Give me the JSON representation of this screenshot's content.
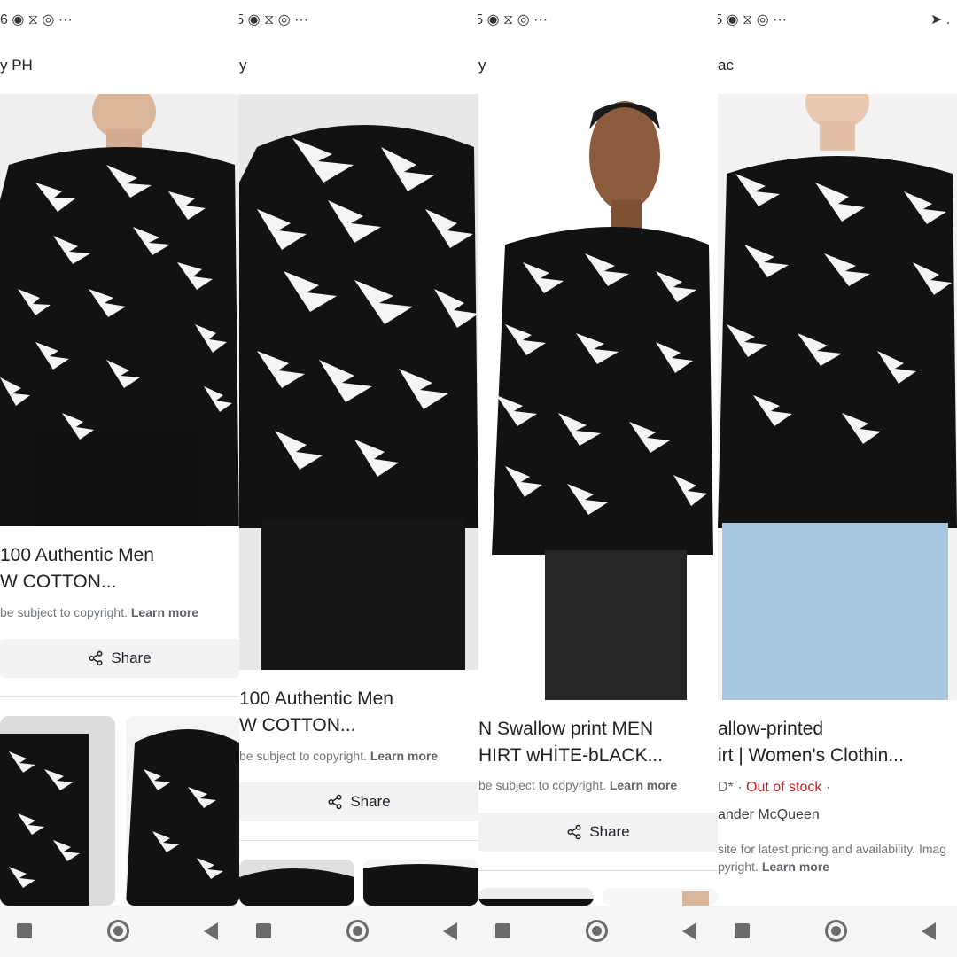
{
  "status": {
    "p1": "6 ◉ ⧖ ◎  ···",
    "p2": "➤ .5 ◉ ⧖ ◎  ···",
    "p3": "➤ .5 ◉ ⧖ ◎  ···",
    "p4": "➤ .5 ◉ ⧖ ◎  ···",
    "p5": "➤ ."
  },
  "panels": [
    {
      "site": "y PH",
      "title_line1": "100 Authentic Men",
      "title_line2": "W COTTON...",
      "copyright_text": "be subject to copyright.",
      "learn_more": "Learn more",
      "share_label": "Share"
    },
    {
      "site": "y",
      "title_line1": "100 Authentic Men",
      "title_line2": "W COTTON...",
      "copyright_text": "be subject to copyright.",
      "learn_more": "Learn more",
      "share_label": "Share"
    },
    {
      "site": "y",
      "title_line1": "N Swallow print MEN",
      "title_line2": "HIRT wHİTE-bLACK...",
      "copyright_text": "be subject to copyright.",
      "learn_more": "Learn more",
      "share_label": "Share"
    },
    {
      "site": "ac",
      "title_line1": "allow-printed",
      "title_line2": "irt | Women's Clothin...",
      "price_prefix": "D* ·",
      "stock_status": "Out of stock",
      "stock_suffix": "·",
      "brand": "ander McQueen",
      "notice_line1": "site for latest pricing and availability. Imag",
      "notice_line2": "pyright.",
      "learn_more": "Learn more"
    }
  ],
  "icons": {
    "share": "share-icon",
    "recents": "recent-apps-icon",
    "home": "home-icon",
    "back": "back-icon"
  },
  "colors": {
    "sweater": "#121212",
    "swallow": "#f4f4f4",
    "out_of_stock": "#c5221f",
    "share_bg": "#f1f3f4",
    "jeans": "#a9c6e0"
  }
}
